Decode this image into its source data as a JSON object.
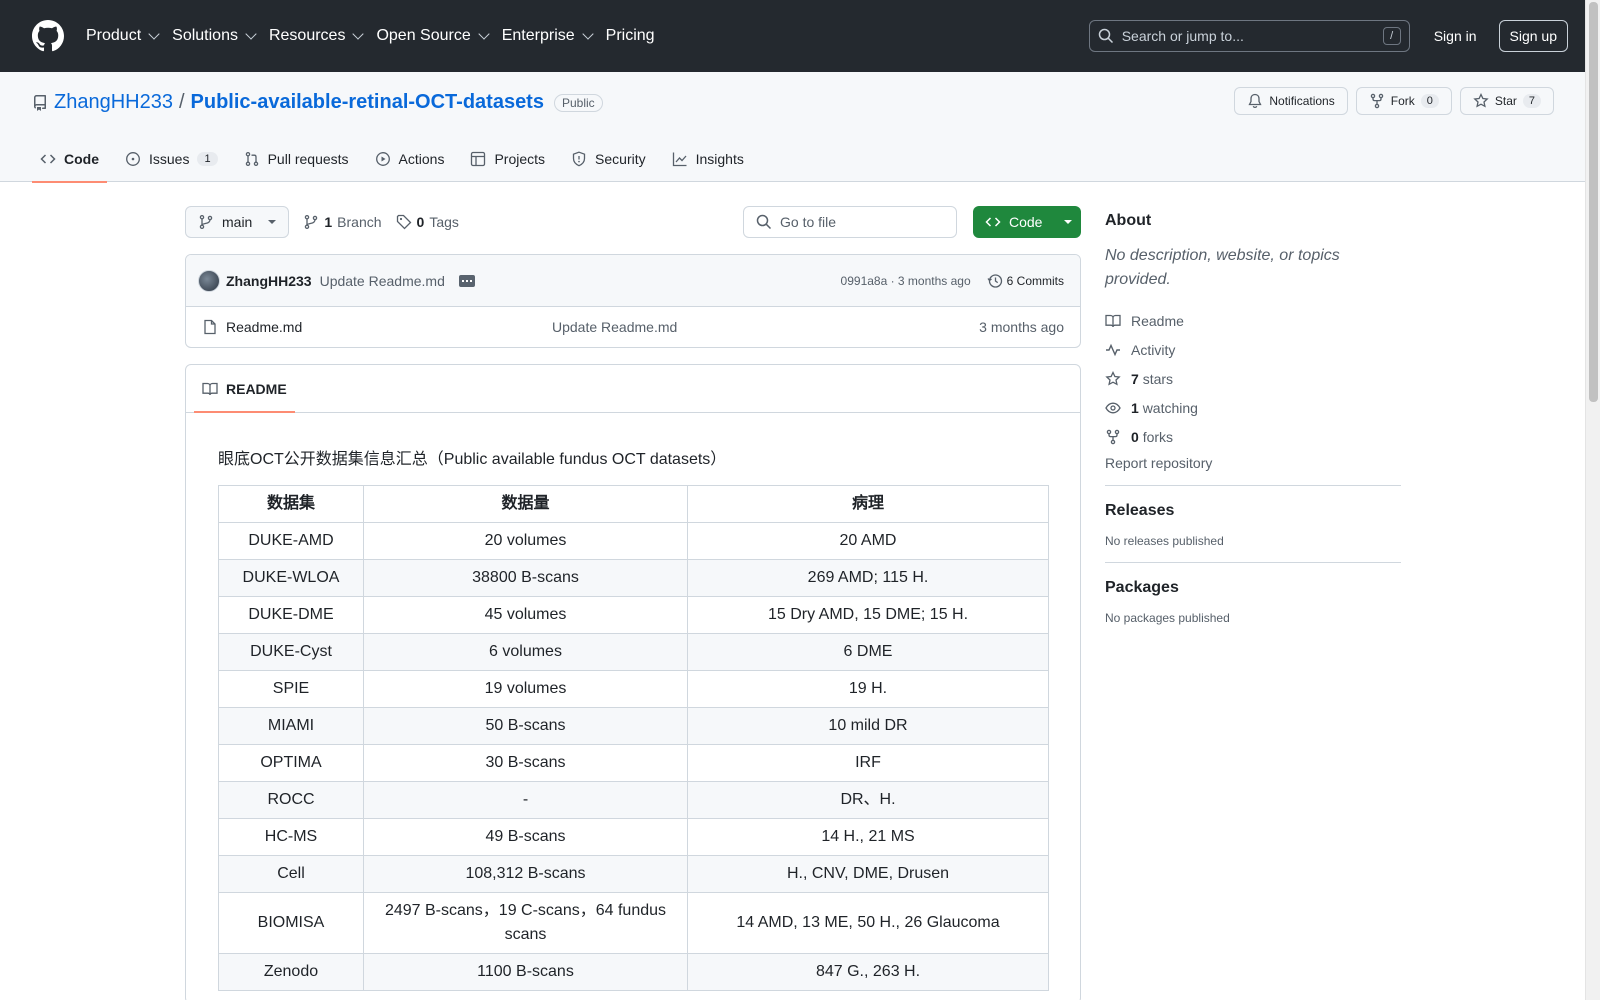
{
  "header": {
    "nav": [
      "Product",
      "Solutions",
      "Resources",
      "Open Source",
      "Enterprise"
    ],
    "pricing": "Pricing",
    "search_placeholder": "Search or jump to...",
    "search_key": "/",
    "sign_in": "Sign in",
    "sign_up": "Sign up"
  },
  "repo": {
    "owner": "ZhangHH233",
    "separator": "/",
    "name": "Public-available-retinal-OCT-datasets",
    "visibility": "Public",
    "notifications_label": "Notifications",
    "fork_label": "Fork",
    "fork_count": "0",
    "star_label": "Star",
    "star_count": "7"
  },
  "tabs": {
    "code": "Code",
    "issues": "Issues",
    "issues_count": "1",
    "pulls": "Pull requests",
    "actions": "Actions",
    "projects": "Projects",
    "security": "Security",
    "insights": "Insights"
  },
  "toolbar": {
    "branch": "main",
    "branch_count": "1",
    "branch_label": "Branch",
    "tag_count": "0",
    "tag_label": "Tags",
    "goto_placeholder": "Go to file",
    "code_button": "Code"
  },
  "commit": {
    "author": "ZhangHH233",
    "message": "Update Readme.md",
    "hash_time": "0991a8a · 3 months ago",
    "commits": "6 Commits"
  },
  "files": [
    {
      "name": "Readme.md",
      "message": "Update Readme.md",
      "date": "3 months ago"
    }
  ],
  "readme": {
    "tab": "README",
    "intro": "眼底OCT公开数据集信息汇总（Public available fundus OCT datasets）",
    "headers": [
      "数据集",
      "数据量",
      "病理"
    ],
    "rows": [
      [
        "DUKE-AMD",
        "20 volumes",
        "20 AMD"
      ],
      [
        "DUKE-WLOA",
        "38800 B-scans",
        "269 AMD; 115 H."
      ],
      [
        "DUKE-DME",
        "45 volumes",
        "15 Dry AMD, 15 DME; 15 H."
      ],
      [
        "DUKE-Cyst",
        "6 volumes",
        "6 DME"
      ],
      [
        "SPIE",
        "19 volumes",
        "19 H."
      ],
      [
        "MIAMI",
        "50 B-scans",
        "10 mild DR"
      ],
      [
        "OPTIMA",
        "30 B-scans",
        "IRF"
      ],
      [
        "ROCC",
        "-",
        "DR、H."
      ],
      [
        "HC-MS",
        "49 B-scans",
        "14 H., 21 MS"
      ],
      [
        "Cell",
        "108,312 B-scans",
        "H., CNV, DME, Drusen"
      ],
      [
        "BIOMISA",
        "2497 B-scans，19 C-scans，64 fundus scans",
        "14 AMD, 13 ME, 50 H., 26 Glaucoma"
      ],
      [
        "Zenodo",
        "1100 B-scans",
        "847 G., 263 H."
      ]
    ]
  },
  "sidebar": {
    "about_title": "About",
    "about_desc": "No description, website, or topics provided.",
    "readme": "Readme",
    "activity": "Activity",
    "stars_count": "7",
    "stars_label": "stars",
    "watching_count": "1",
    "watching_label": "watching",
    "forks_count": "0",
    "forks_label": "forks",
    "report": "Report repository",
    "releases_title": "Releases",
    "releases_empty": "No releases published",
    "packages_title": "Packages",
    "packages_empty": "No packages published"
  }
}
